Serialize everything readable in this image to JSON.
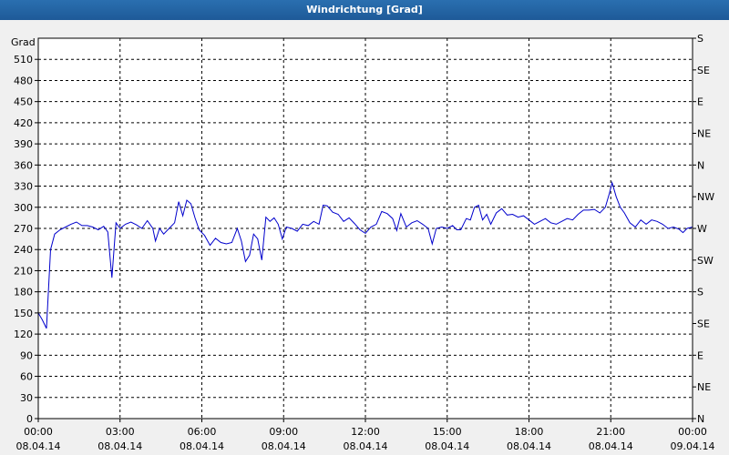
{
  "window": {
    "title": "Windrichtung [Grad]"
  },
  "chart_data": {
    "type": "line",
    "title": "Windrichtung [Grad]",
    "ylabel": "Grad",
    "xlim": [
      0,
      24
    ],
    "ylim": [
      0,
      540
    ],
    "grid": true,
    "y_ticks": [
      0,
      30,
      60,
      90,
      120,
      150,
      180,
      210,
      240,
      270,
      300,
      330,
      360,
      390,
      420,
      450,
      480,
      510
    ],
    "right_ticks": [
      {
        "value": 0,
        "label": "N"
      },
      {
        "value": 45,
        "label": "NE"
      },
      {
        "value": 90,
        "label": "E"
      },
      {
        "value": 135,
        "label": "SE"
      },
      {
        "value": 180,
        "label": "S"
      },
      {
        "value": 225,
        "label": "SW"
      },
      {
        "value": 270,
        "label": "W"
      },
      {
        "value": 315,
        "label": "NW"
      },
      {
        "value": 360,
        "label": "N"
      },
      {
        "value": 405,
        "label": "NE"
      },
      {
        "value": 450,
        "label": "E"
      },
      {
        "value": 495,
        "label": "SE"
      },
      {
        "value": 540,
        "label": "S"
      }
    ],
    "x_ticks": [
      {
        "value": 0,
        "time": "00:00",
        "date": "08.04.14"
      },
      {
        "value": 3,
        "time": "03:00",
        "date": "08.04.14"
      },
      {
        "value": 6,
        "time": "06:00",
        "date": "08.04.14"
      },
      {
        "value": 9,
        "time": "09:00",
        "date": "08.04.14"
      },
      {
        "value": 12,
        "time": "12:00",
        "date": "08.04.14"
      },
      {
        "value": 15,
        "time": "15:00",
        "date": "08.04.14"
      },
      {
        "value": 18,
        "time": "18:00",
        "date": "08.04.14"
      },
      {
        "value": 21,
        "time": "21:00",
        "date": "08.04.14"
      },
      {
        "value": 24,
        "time": "00:00",
        "date": "09.04.14"
      }
    ],
    "series": [
      {
        "color": "#0000cc",
        "points": [
          [
            0.0,
            150
          ],
          [
            0.15,
            140
          ],
          [
            0.3,
            128
          ],
          [
            0.45,
            240
          ],
          [
            0.6,
            262
          ],
          [
            0.8,
            268
          ],
          [
            1.0,
            272
          ],
          [
            1.2,
            276
          ],
          [
            1.4,
            279
          ],
          [
            1.6,
            274
          ],
          [
            1.8,
            274
          ],
          [
            2.0,
            272
          ],
          [
            2.2,
            268
          ],
          [
            2.4,
            273
          ],
          [
            2.55,
            265
          ],
          [
            2.7,
            200
          ],
          [
            2.85,
            278
          ],
          [
            3.0,
            270
          ],
          [
            3.2,
            276
          ],
          [
            3.4,
            279
          ],
          [
            3.6,
            275
          ],
          [
            3.8,
            270
          ],
          [
            4.0,
            281
          ],
          [
            4.2,
            270
          ],
          [
            4.3,
            252
          ],
          [
            4.45,
            270
          ],
          [
            4.6,
            262
          ],
          [
            4.8,
            270
          ],
          [
            5.0,
            278
          ],
          [
            5.15,
            308
          ],
          [
            5.3,
            288
          ],
          [
            5.45,
            310
          ],
          [
            5.6,
            305
          ],
          [
            5.75,
            285
          ],
          [
            5.9,
            268
          ],
          [
            6.1,
            260
          ],
          [
            6.3,
            246
          ],
          [
            6.5,
            256
          ],
          [
            6.7,
            250
          ],
          [
            6.9,
            248
          ],
          [
            7.1,
            250
          ],
          [
            7.3,
            270
          ],
          [
            7.45,
            252
          ],
          [
            7.6,
            223
          ],
          [
            7.75,
            232
          ],
          [
            7.9,
            262
          ],
          [
            8.05,
            255
          ],
          [
            8.2,
            225
          ],
          [
            8.35,
            286
          ],
          [
            8.5,
            280
          ],
          [
            8.65,
            285
          ],
          [
            8.8,
            276
          ],
          [
            8.95,
            255
          ],
          [
            9.1,
            272
          ],
          [
            9.3,
            270
          ],
          [
            9.5,
            266
          ],
          [
            9.7,
            276
          ],
          [
            9.9,
            274
          ],
          [
            10.1,
            280
          ],
          [
            10.3,
            276
          ],
          [
            10.45,
            303
          ],
          [
            10.6,
            302
          ],
          [
            10.8,
            293
          ],
          [
            11.0,
            290
          ],
          [
            11.2,
            280
          ],
          [
            11.4,
            285
          ],
          [
            11.6,
            277
          ],
          [
            11.8,
            268
          ],
          [
            12.0,
            263
          ],
          [
            12.2,
            272
          ],
          [
            12.4,
            276
          ],
          [
            12.6,
            294
          ],
          [
            12.8,
            291
          ],
          [
            13.0,
            284
          ],
          [
            13.15,
            267
          ],
          [
            13.3,
            291
          ],
          [
            13.5,
            272
          ],
          [
            13.7,
            278
          ],
          [
            13.9,
            281
          ],
          [
            14.1,
            276
          ],
          [
            14.3,
            270
          ],
          [
            14.45,
            248
          ],
          [
            14.6,
            270
          ],
          [
            14.8,
            272
          ],
          [
            15.0,
            270
          ],
          [
            15.2,
            274
          ],
          [
            15.35,
            268
          ],
          [
            15.5,
            268
          ],
          [
            15.7,
            284
          ],
          [
            15.85,
            282
          ],
          [
            16.0,
            300
          ],
          [
            16.15,
            303
          ],
          [
            16.3,
            282
          ],
          [
            16.45,
            290
          ],
          [
            16.6,
            276
          ],
          [
            16.8,
            292
          ],
          [
            17.0,
            298
          ],
          [
            17.2,
            289
          ],
          [
            17.4,
            290
          ],
          [
            17.6,
            286
          ],
          [
            17.8,
            288
          ],
          [
            18.0,
            282
          ],
          [
            18.2,
            276
          ],
          [
            18.4,
            280
          ],
          [
            18.6,
            284
          ],
          [
            18.8,
            278
          ],
          [
            19.0,
            276
          ],
          [
            19.2,
            280
          ],
          [
            19.4,
            284
          ],
          [
            19.6,
            282
          ],
          [
            19.8,
            290
          ],
          [
            20.0,
            296
          ],
          [
            20.2,
            296
          ],
          [
            20.4,
            297
          ],
          [
            20.6,
            292
          ],
          [
            20.8,
            300
          ],
          [
            20.95,
            320
          ],
          [
            21.05,
            335
          ],
          [
            21.2,
            315
          ],
          [
            21.35,
            300
          ],
          [
            21.5,
            292
          ],
          [
            21.7,
            278
          ],
          [
            21.9,
            272
          ],
          [
            22.1,
            282
          ],
          [
            22.3,
            276
          ],
          [
            22.5,
            282
          ],
          [
            22.7,
            280
          ],
          [
            22.9,
            276
          ],
          [
            23.1,
            270
          ],
          [
            23.3,
            272
          ],
          [
            23.5,
            269
          ],
          [
            23.65,
            264
          ],
          [
            23.8,
            270
          ],
          [
            24.0,
            272
          ]
        ]
      }
    ]
  }
}
